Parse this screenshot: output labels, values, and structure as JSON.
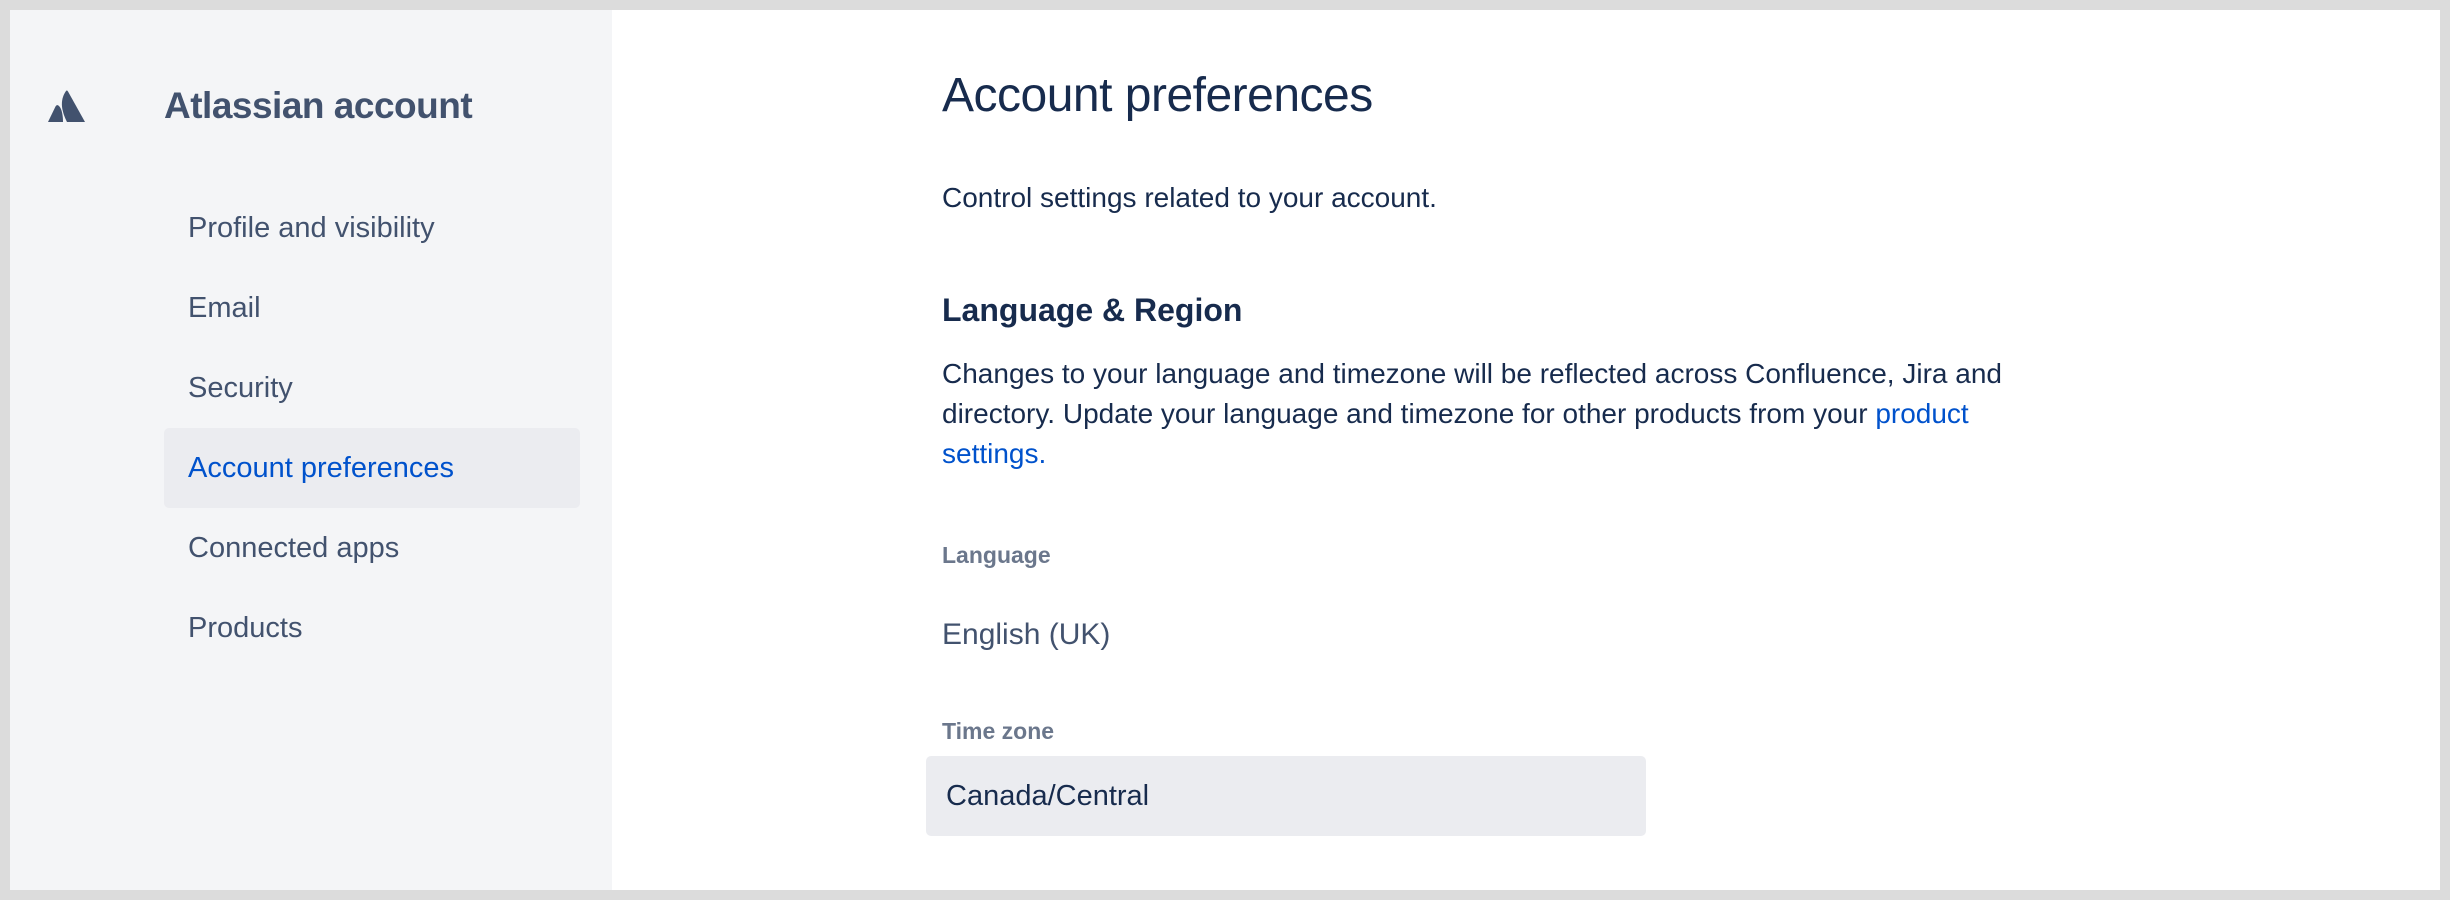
{
  "app": {
    "title": "Atlassian account",
    "logo_icon": "atlassian-logo-icon"
  },
  "sidebar": {
    "items": [
      {
        "label": "Profile and visibility",
        "active": false
      },
      {
        "label": "Email",
        "active": false
      },
      {
        "label": "Security",
        "active": false
      },
      {
        "label": "Account preferences",
        "active": true
      },
      {
        "label": "Connected apps",
        "active": false
      },
      {
        "label": "Products",
        "active": false
      }
    ]
  },
  "main": {
    "title": "Account preferences",
    "subtitle": "Control settings related to your account.",
    "section": {
      "title": "Language & Region",
      "description_text": "Changes to your language and timezone will be reflected across Confluence, Jira and directory. Update your language and timezone for other products from your ",
      "description_link": "product settings."
    },
    "language": {
      "label": "Language",
      "value": "English (UK)"
    },
    "timezone": {
      "label": "Time zone",
      "value": "Canada/Central"
    }
  },
  "colors": {
    "sidebar_bg": "#f4f5f7",
    "active_bg": "#ebecf0",
    "accent": "#0052cc",
    "text_primary": "#172b4d",
    "text_secondary": "#42526e",
    "label": "#6b778c"
  }
}
